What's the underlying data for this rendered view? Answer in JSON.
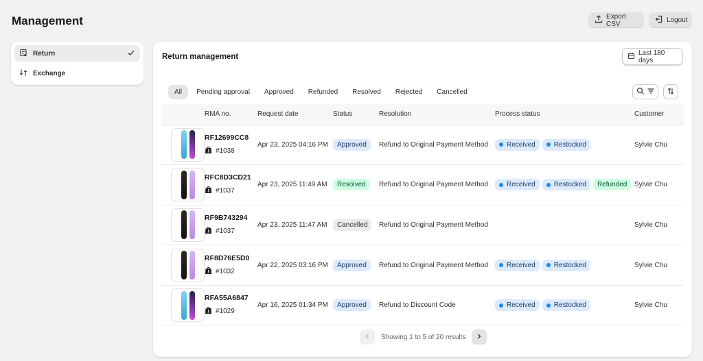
{
  "page": {
    "title": "Management"
  },
  "header": {
    "export_label": "Export CSV",
    "logout_label": "Logout"
  },
  "sidebar": {
    "items": [
      {
        "label": "Return",
        "icon": "return-icon"
      },
      {
        "label": "Exchange",
        "icon": "exchange-icon"
      }
    ]
  },
  "card": {
    "title": "Return management",
    "date_range_label": "Last 180 days"
  },
  "tabs": [
    "All",
    "Pending approval",
    "Approved",
    "Refunded",
    "Resolved",
    "Rejected",
    "Cancelled"
  ],
  "table": {
    "headers": [
      "",
      "RMA no.",
      "Request date",
      "Status",
      "Resolution",
      "Process status",
      "Customer"
    ],
    "rows": [
      {
        "thumb": "blue-purple",
        "rma": "RF12699CC8",
        "order": "#1038",
        "date": "Apr 23, 2025 04:16 PM",
        "status": "Approved",
        "resolution": "Refund to Original Payment Method",
        "process": [
          "Received",
          "Restocked"
        ],
        "customer": "Sylvie Chu"
      },
      {
        "thumb": "black-lilac",
        "rma": "RFC8D3CD21",
        "order": "#1037",
        "date": "Apr 23, 2025 11:49 AM",
        "status": "Resolved",
        "resolution": "Refund to Original Payment Method",
        "process": [
          "Received",
          "Restocked",
          "Refunded"
        ],
        "customer": "Sylvie Chu"
      },
      {
        "thumb": "black-lilac",
        "rma": "RF9B743294",
        "order": "#1037",
        "date": "Apr 23, 2025 11:47 AM",
        "status": "Cancelled",
        "resolution": "Refund to Original Payment Method",
        "process": [],
        "customer": "Sylvie Chu"
      },
      {
        "thumb": "black-lilac",
        "rma": "RF8D76E5D0",
        "order": "#1032",
        "date": "Apr 22, 2025 03:16 PM",
        "status": "Approved",
        "resolution": "Refund to Original Payment Method",
        "process": [
          "Received",
          "Restocked"
        ],
        "customer": "Sylvie Chu"
      },
      {
        "thumb": "blue-purple",
        "rma": "RFA55A6847",
        "order": "#1029",
        "date": "Apr 16, 2025 01:34 PM",
        "status": "Approved",
        "resolution": "Refund to Discount Code",
        "process": [
          "Received",
          "Restocked"
        ],
        "customer": "Sylvie Chu"
      }
    ]
  },
  "pagination": {
    "label": "Showing 1 to 5 of 20 results"
  },
  "colors": {
    "approved_bg": "#dbeafe",
    "approved_text": "#1e3a5f",
    "resolved_bg": "#cdfee1",
    "resolved_text": "#0c5132",
    "cancelled_bg": "#ebebeb",
    "dot_blue": "#1e88e5"
  }
}
